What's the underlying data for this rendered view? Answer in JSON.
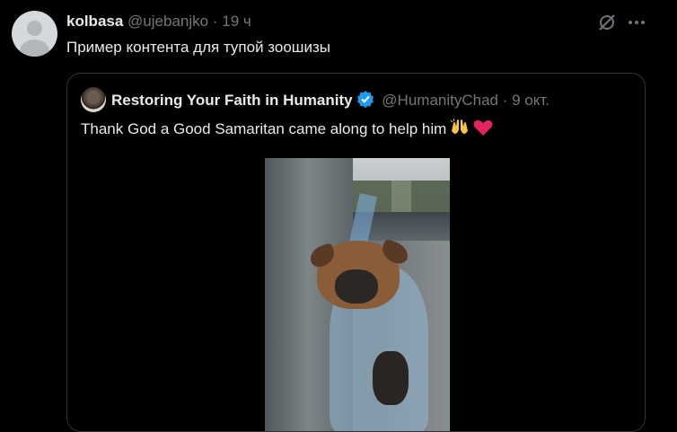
{
  "tweet": {
    "author_name": "kolbasa",
    "author_handle": "@ujebanjko",
    "separator": "·",
    "time": "19 ч",
    "text": "Пример контента для тупой зоошизы"
  },
  "actions": {
    "grok_icon": "grok-slash-icon",
    "more_icon": "more-dots-icon"
  },
  "quote": {
    "author_name": "Restoring Your Faith in Humanity",
    "author_handle": "@HumanityChad",
    "separator": "·",
    "date": "9 окт.",
    "text": "Thank God a Good Samaritan came along to help him",
    "emojis": [
      "raising-hands-emoji",
      "red-heart-emoji"
    ],
    "verified_color": "#1d9bf0",
    "media": {
      "type": "video",
      "subject": "puppy-in-plastic-bag"
    }
  },
  "colors": {
    "background": "#000000",
    "text": "#e7e9ea",
    "muted": "#71767b",
    "border": "#2f3336",
    "accent": "#1d9bf0"
  }
}
